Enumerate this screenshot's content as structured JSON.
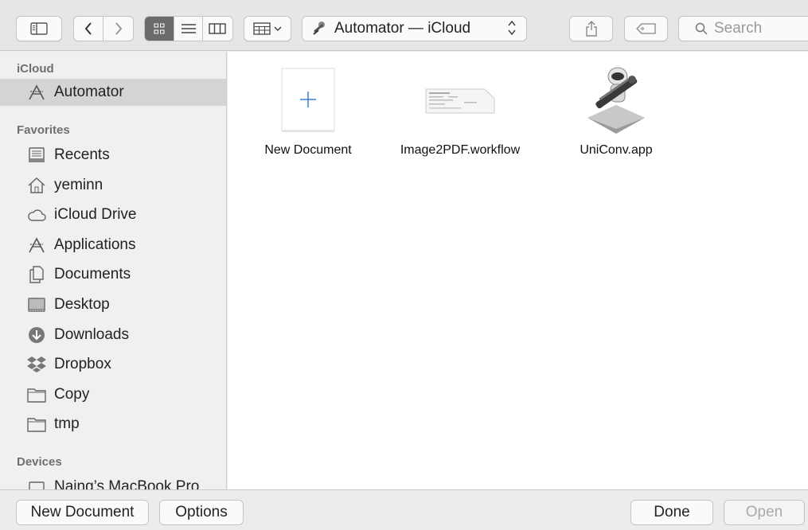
{
  "toolbar": {
    "location": "Automator — iCloud",
    "search_placeholder": "Search"
  },
  "sidebar": {
    "sections": [
      {
        "title": "iCloud"
      },
      {
        "title": "Favorites"
      },
      {
        "title": "Devices"
      }
    ],
    "icloud_items": [
      {
        "label": "Automator",
        "icon": "automator-icon",
        "selected": true
      }
    ],
    "favorites": [
      {
        "label": "Recents",
        "icon": "recents-icon"
      },
      {
        "label": "yeminn",
        "icon": "home-icon"
      },
      {
        "label": "iCloud Drive",
        "icon": "cloud-icon"
      },
      {
        "label": "Applications",
        "icon": "applications-icon"
      },
      {
        "label": "Documents",
        "icon": "documents-icon"
      },
      {
        "label": "Desktop",
        "icon": "desktop-icon"
      },
      {
        "label": "Downloads",
        "icon": "downloads-icon"
      },
      {
        "label": "Dropbox",
        "icon": "dropbox-icon"
      },
      {
        "label": "Copy",
        "icon": "folder-icon"
      },
      {
        "label": "tmp",
        "icon": "folder-icon"
      }
    ],
    "devices": [
      {
        "label": "Naing’s MacBook Pro",
        "icon": "laptop-icon"
      }
    ]
  },
  "files": [
    {
      "name": "New Document",
      "icon": "new-document-icon"
    },
    {
      "name": "Image2PDF.workflow",
      "icon": "workflow-file-icon"
    },
    {
      "name": "UniConv.app",
      "icon": "automator-app-icon"
    }
  ],
  "bottom": {
    "new_document": "New Document",
    "options": "Options",
    "done": "Done",
    "open": "Open"
  }
}
